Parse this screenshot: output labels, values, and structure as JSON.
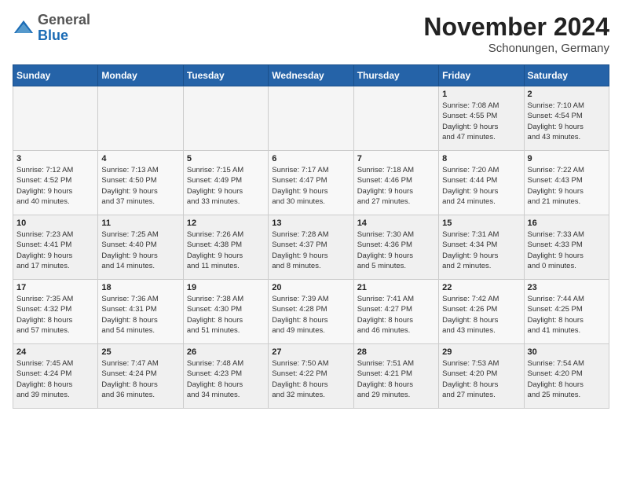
{
  "header": {
    "logo_general": "General",
    "logo_blue": "Blue",
    "month_title": "November 2024",
    "location": "Schonungen, Germany"
  },
  "days_of_week": [
    "Sunday",
    "Monday",
    "Tuesday",
    "Wednesday",
    "Thursday",
    "Friday",
    "Saturday"
  ],
  "weeks": [
    [
      {
        "day": "",
        "info": ""
      },
      {
        "day": "",
        "info": ""
      },
      {
        "day": "",
        "info": ""
      },
      {
        "day": "",
        "info": ""
      },
      {
        "day": "",
        "info": ""
      },
      {
        "day": "1",
        "info": "Sunrise: 7:08 AM\nSunset: 4:55 PM\nDaylight: 9 hours\nand 47 minutes."
      },
      {
        "day": "2",
        "info": "Sunrise: 7:10 AM\nSunset: 4:54 PM\nDaylight: 9 hours\nand 43 minutes."
      }
    ],
    [
      {
        "day": "3",
        "info": "Sunrise: 7:12 AM\nSunset: 4:52 PM\nDaylight: 9 hours\nand 40 minutes."
      },
      {
        "day": "4",
        "info": "Sunrise: 7:13 AM\nSunset: 4:50 PM\nDaylight: 9 hours\nand 37 minutes."
      },
      {
        "day": "5",
        "info": "Sunrise: 7:15 AM\nSunset: 4:49 PM\nDaylight: 9 hours\nand 33 minutes."
      },
      {
        "day": "6",
        "info": "Sunrise: 7:17 AM\nSunset: 4:47 PM\nDaylight: 9 hours\nand 30 minutes."
      },
      {
        "day": "7",
        "info": "Sunrise: 7:18 AM\nSunset: 4:46 PM\nDaylight: 9 hours\nand 27 minutes."
      },
      {
        "day": "8",
        "info": "Sunrise: 7:20 AM\nSunset: 4:44 PM\nDaylight: 9 hours\nand 24 minutes."
      },
      {
        "day": "9",
        "info": "Sunrise: 7:22 AM\nSunset: 4:43 PM\nDaylight: 9 hours\nand 21 minutes."
      }
    ],
    [
      {
        "day": "10",
        "info": "Sunrise: 7:23 AM\nSunset: 4:41 PM\nDaylight: 9 hours\nand 17 minutes."
      },
      {
        "day": "11",
        "info": "Sunrise: 7:25 AM\nSunset: 4:40 PM\nDaylight: 9 hours\nand 14 minutes."
      },
      {
        "day": "12",
        "info": "Sunrise: 7:26 AM\nSunset: 4:38 PM\nDaylight: 9 hours\nand 11 minutes."
      },
      {
        "day": "13",
        "info": "Sunrise: 7:28 AM\nSunset: 4:37 PM\nDaylight: 9 hours\nand 8 minutes."
      },
      {
        "day": "14",
        "info": "Sunrise: 7:30 AM\nSunset: 4:36 PM\nDaylight: 9 hours\nand 5 minutes."
      },
      {
        "day": "15",
        "info": "Sunrise: 7:31 AM\nSunset: 4:34 PM\nDaylight: 9 hours\nand 2 minutes."
      },
      {
        "day": "16",
        "info": "Sunrise: 7:33 AM\nSunset: 4:33 PM\nDaylight: 9 hours\nand 0 minutes."
      }
    ],
    [
      {
        "day": "17",
        "info": "Sunrise: 7:35 AM\nSunset: 4:32 PM\nDaylight: 8 hours\nand 57 minutes."
      },
      {
        "day": "18",
        "info": "Sunrise: 7:36 AM\nSunset: 4:31 PM\nDaylight: 8 hours\nand 54 minutes."
      },
      {
        "day": "19",
        "info": "Sunrise: 7:38 AM\nSunset: 4:30 PM\nDaylight: 8 hours\nand 51 minutes."
      },
      {
        "day": "20",
        "info": "Sunrise: 7:39 AM\nSunset: 4:28 PM\nDaylight: 8 hours\nand 49 minutes."
      },
      {
        "day": "21",
        "info": "Sunrise: 7:41 AM\nSunset: 4:27 PM\nDaylight: 8 hours\nand 46 minutes."
      },
      {
        "day": "22",
        "info": "Sunrise: 7:42 AM\nSunset: 4:26 PM\nDaylight: 8 hours\nand 43 minutes."
      },
      {
        "day": "23",
        "info": "Sunrise: 7:44 AM\nSunset: 4:25 PM\nDaylight: 8 hours\nand 41 minutes."
      }
    ],
    [
      {
        "day": "24",
        "info": "Sunrise: 7:45 AM\nSunset: 4:24 PM\nDaylight: 8 hours\nand 39 minutes."
      },
      {
        "day": "25",
        "info": "Sunrise: 7:47 AM\nSunset: 4:24 PM\nDaylight: 8 hours\nand 36 minutes."
      },
      {
        "day": "26",
        "info": "Sunrise: 7:48 AM\nSunset: 4:23 PM\nDaylight: 8 hours\nand 34 minutes."
      },
      {
        "day": "27",
        "info": "Sunrise: 7:50 AM\nSunset: 4:22 PM\nDaylight: 8 hours\nand 32 minutes."
      },
      {
        "day": "28",
        "info": "Sunrise: 7:51 AM\nSunset: 4:21 PM\nDaylight: 8 hours\nand 29 minutes."
      },
      {
        "day": "29",
        "info": "Sunrise: 7:53 AM\nSunset: 4:20 PM\nDaylight: 8 hours\nand 27 minutes."
      },
      {
        "day": "30",
        "info": "Sunrise: 7:54 AM\nSunset: 4:20 PM\nDaylight: 8 hours\nand 25 minutes."
      }
    ]
  ]
}
